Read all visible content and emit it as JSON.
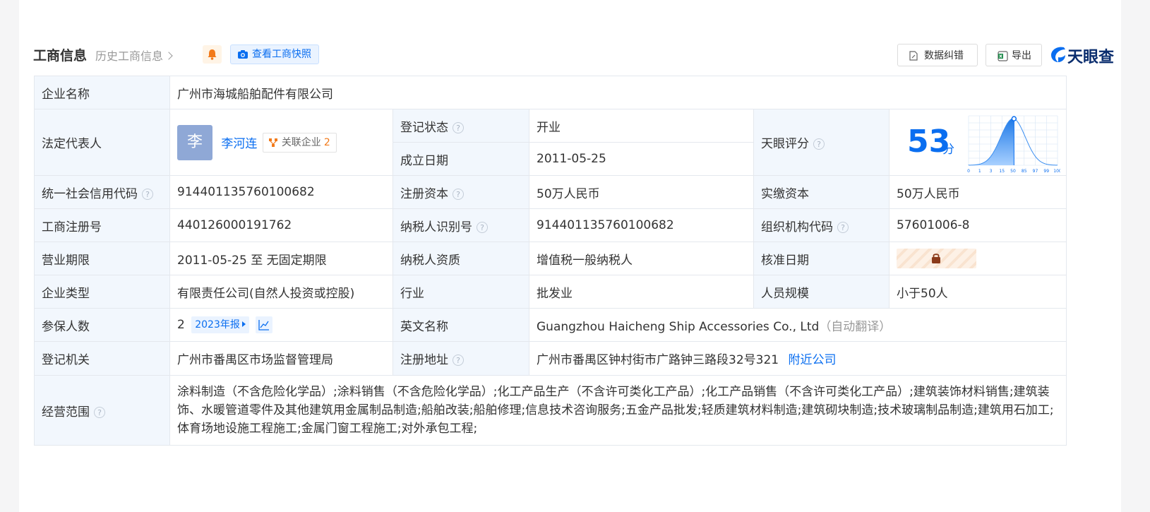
{
  "header": {
    "title": "工商信息",
    "history_link": "历史工商信息",
    "snapshot_button": "查看工商快照",
    "data_fix_button": "数据纠错",
    "export_button": "导出",
    "logo_text": "天眼查",
    "accent_color": "#0a6ef0"
  },
  "company": {
    "name_label": "企业名称",
    "name": "广州市海城船舶配件有限公司",
    "legal_rep_label": "法定代表人",
    "legal_rep_avatar": "李",
    "legal_rep": "李河连",
    "related_label": "关联企业",
    "related_count": "2",
    "reg_status_label": "登记状态",
    "reg_status": "开业",
    "founded_label": "成立日期",
    "founded": "2011-05-25",
    "score_label": "天眼评分",
    "score": "53",
    "score_unit": "分",
    "credit_code_label": "统一社会信用代码",
    "credit_code": "914401135760100682",
    "reg_capital_label": "注册资本",
    "reg_capital": "50万人民币",
    "paid_capital_label": "实缴资本",
    "paid_capital": "50万人民币",
    "biz_reg_no_label": "工商注册号",
    "biz_reg_no": "440126000191762",
    "taxpayer_id_label": "纳税人识别号",
    "taxpayer_id": "914401135760100682",
    "org_code_label": "组织机构代码",
    "org_code": "57601006-8",
    "term_label": "营业期限",
    "term": "2011-05-25 至 无固定期限",
    "taxpayer_type_label": "纳税人资质",
    "taxpayer_type": "增值税一般纳税人",
    "approval_date_label": "核准日期",
    "company_type_label": "企业类型",
    "company_type": "有限责任公司(自然人投资或控股)",
    "industry_label": "行业",
    "industry": "批发业",
    "staff_size_label": "人员规模",
    "staff_size": "小于50人",
    "insured_label": "参保人数",
    "insured": "2",
    "insured_report": "2023年报",
    "english_name_label": "英文名称",
    "english_name": "Guangzhou Haicheng Ship Accessories Co., Ltd",
    "auto_translate": "（自动翻译）",
    "authority_label": "登记机关",
    "authority": "广州市番禺区市场监督管理局",
    "address_label": "注册地址",
    "address": "广州市番禺区钟村街市广路钟三路段32号321",
    "nearby_link": "附近公司",
    "scope_label": "经营范围",
    "scope": "涂料制造（不含危险化学品）;涂料销售（不含危险化学品）;化工产品生产（不含许可类化工产品）;化工产品销售（不含许可类化工产品）;建筑装饰材料销售;建筑装饰、水暖管道零件及其他建筑用金属制品制造;船舶改装;船舶修理;信息技术咨询服务;五金产品批发;轻质建筑材料制造;建筑砌块制造;技术玻璃制品制造;建筑用石加工;体育场地设施工程施工;金属门窗工程施工;对外承包工程;"
  },
  "score_chart": {
    "ticks": [
      "0",
      "1",
      "3",
      "15",
      "50",
      "85",
      "97",
      "99",
      "100"
    ],
    "marker_value": 53,
    "colors": {
      "fill": "#3b8ef0",
      "grid": "#d6e4f5"
    }
  },
  "icons": {
    "bell": "bell-icon",
    "camera": "camera-icon",
    "edit_doc": "edit-document-icon",
    "excel": "excel-icon",
    "lock": "lock-icon",
    "network": "network-icon",
    "trend": "trend-chart-icon",
    "help": "question-icon"
  }
}
